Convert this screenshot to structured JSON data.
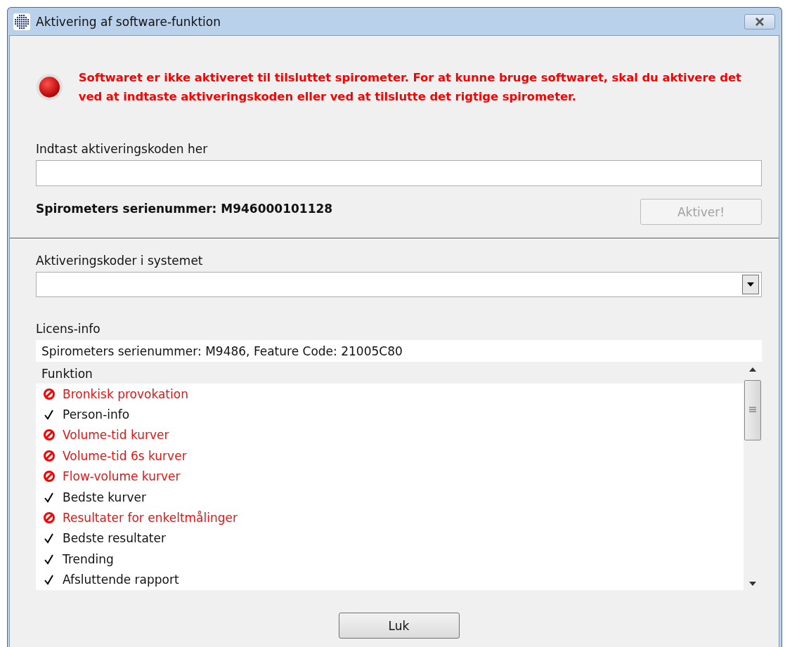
{
  "window": {
    "title": "Aktivering af software-funktion"
  },
  "status": {
    "kind": "error",
    "message": "Softwaret er ikke aktiveret til tilsluttet spirometer. For at kunne bruge softwaret, skal du aktivere det ved at indtaste aktiveringskoden eller ved at tilslutte det rigtige spirometer."
  },
  "code_field": {
    "label": "Indtast aktiveringskoden her"
  },
  "serial": "Spirometers serienummer: M946000101128",
  "activate_button": {
    "label": "Aktiver!",
    "disabled": true
  },
  "codes_dropdown": {
    "label": "Aktiveringskoder i systemet"
  },
  "license": {
    "label": "Licens-info",
    "info": "Spirometers serienummer: M9486, Feature Code: 21005C80",
    "column": "Funktion",
    "items": [
      {
        "label": "Bronkisk provokation",
        "kind": "blocked"
      },
      {
        "label": "Person-info",
        "kind": "check"
      },
      {
        "label": "Volume-tid kurver",
        "kind": "blocked"
      },
      {
        "label": "Volume-tid 6s kurver",
        "kind": "blocked"
      },
      {
        "label": "Flow-volume kurver",
        "kind": "blocked"
      },
      {
        "label": "Bedste kurver",
        "kind": "check"
      },
      {
        "label": "Resultater for enkeltmålinger",
        "kind": "blocked"
      },
      {
        "label": "Bedste resultater",
        "kind": "check"
      },
      {
        "label": "Trending",
        "kind": "check"
      },
      {
        "label": "Afsluttende rapport",
        "kind": "check"
      }
    ]
  },
  "close_button": "Luk"
}
